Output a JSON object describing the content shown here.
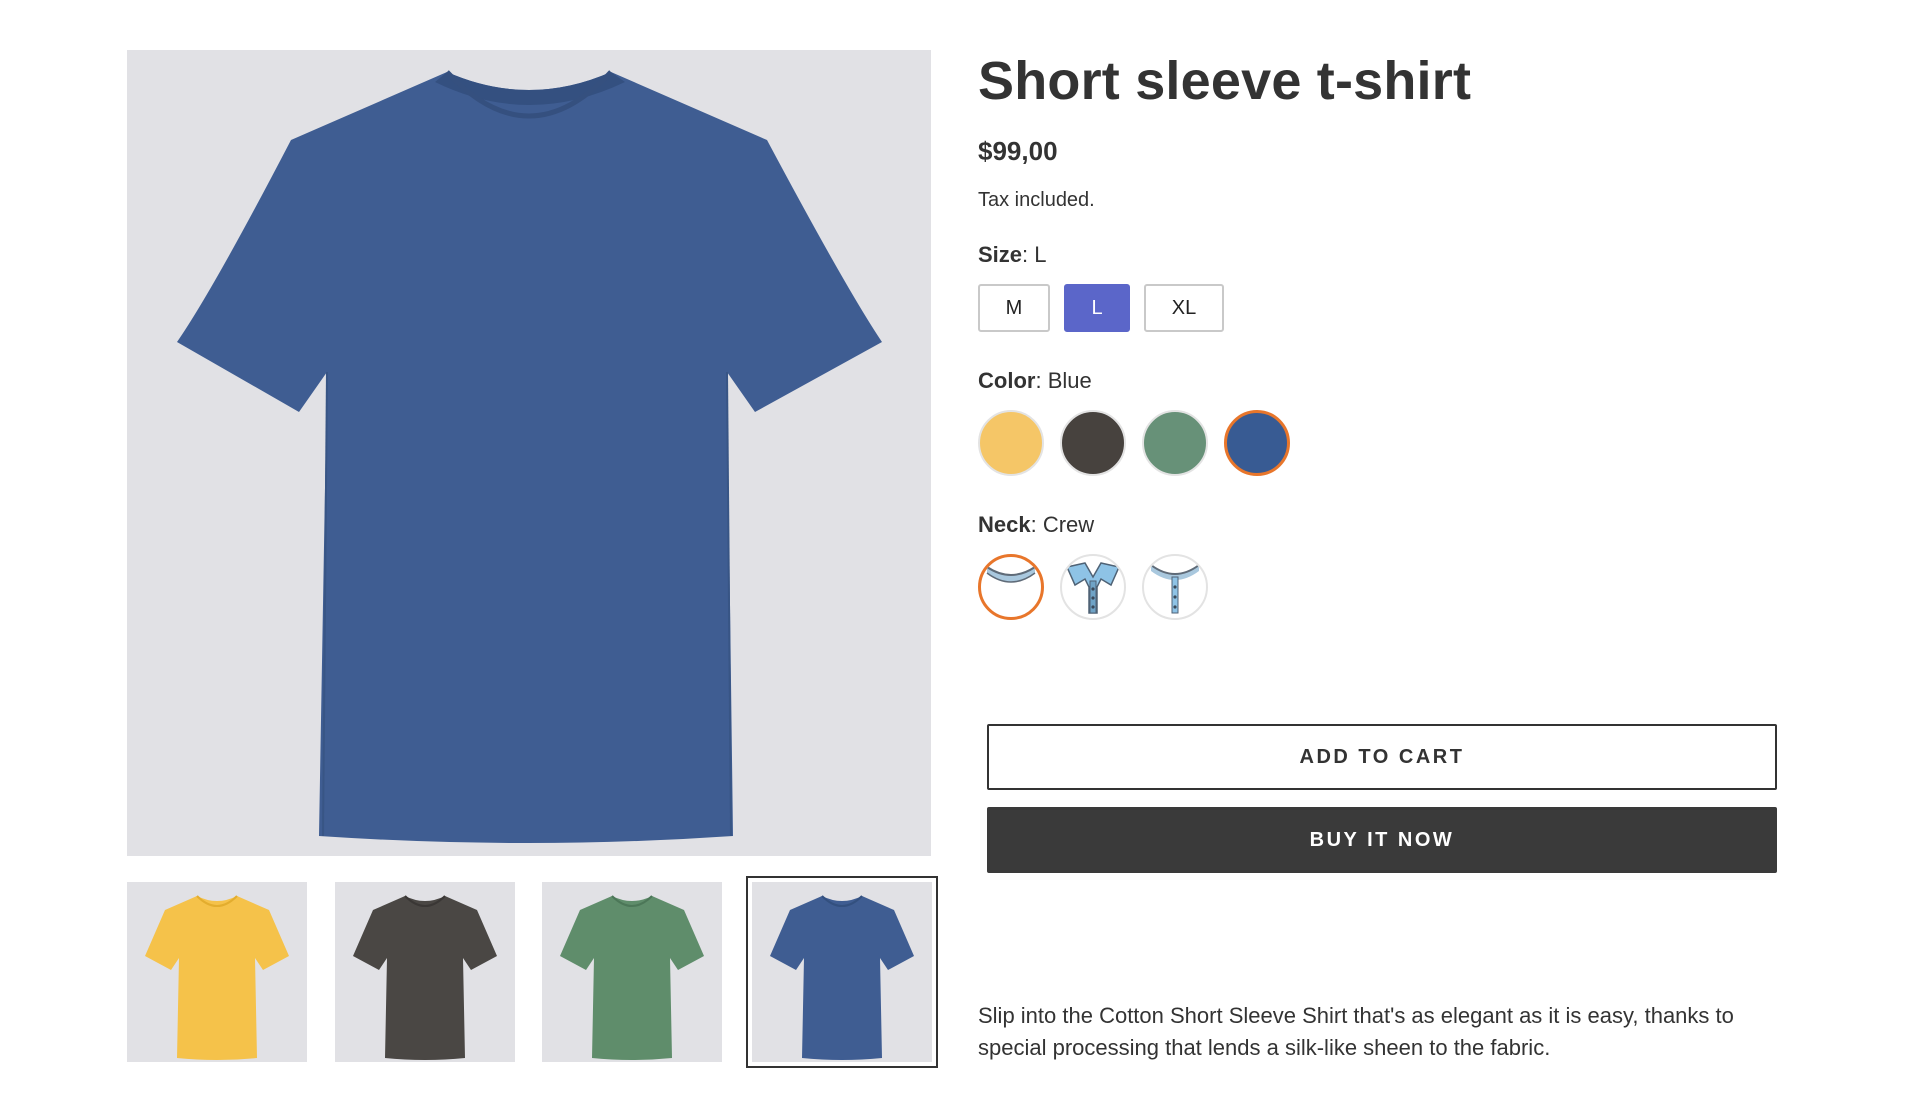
{
  "product": {
    "title": "Short sleeve t-shirt",
    "price": "$99,00",
    "tax_note": "Tax included.",
    "description": "Slip into the Cotton Short Sleeve Shirt that's as elegant as it is easy, thanks to special processing that lends a silk-like sheen to the fabric."
  },
  "gallery": {
    "main_image_color": "#3f5d92",
    "thumbnails": [
      {
        "color": "#f5c24a",
        "name": "yellow"
      },
      {
        "color": "#4a4744",
        "name": "charcoal"
      },
      {
        "color": "#5f8d6b",
        "name": "green"
      },
      {
        "color": "#3f5d92",
        "name": "blue"
      }
    ],
    "selected_index": 3
  },
  "options": {
    "size": {
      "label": "Size",
      "value": "L",
      "choices": [
        "M",
        "L",
        "XL"
      ]
    },
    "color": {
      "label": "Color",
      "value": "Blue",
      "swatches": [
        {
          "name": "Yellow",
          "hex": "#f5c667"
        },
        {
          "name": "Charcoal",
          "hex": "#47423e"
        },
        {
          "name": "Green",
          "hex": "#679178"
        },
        {
          "name": "Blue",
          "hex": "#385b93"
        }
      ]
    },
    "neck": {
      "label": "Neck",
      "value": "Crew",
      "styles": [
        "crew-neck-icon",
        "polo-collar-icon",
        "henley-neck-icon"
      ]
    }
  },
  "actions": {
    "add_to_cart": "ADD TO CART",
    "buy_now": "BUY IT NOW"
  },
  "colors": {
    "accent": "#5b66c9",
    "selected_ring": "#e8762b",
    "dark_button": "#3a3a3a"
  }
}
